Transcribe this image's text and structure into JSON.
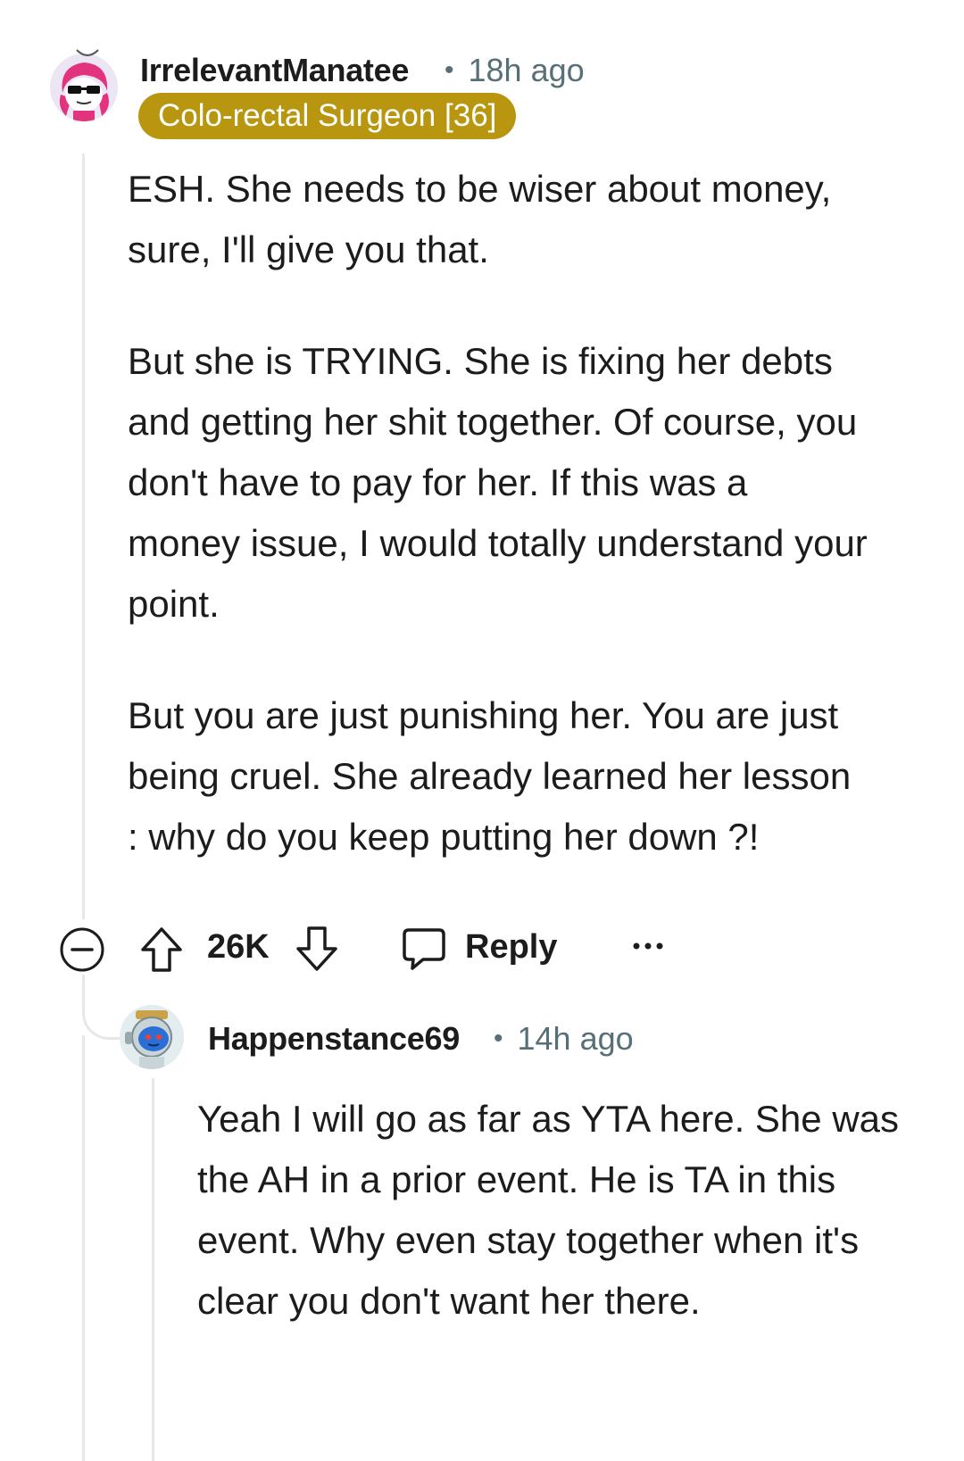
{
  "comment1": {
    "username": "IrrelevantManatee",
    "time": "18h ago",
    "flair": "Colo-rectal Surgeon [36]",
    "avatar_icon": "sunglasses-avatar-icon",
    "paragraphs": [
      "ESH. She needs to be wiser about money, sure, I'll give you that.",
      "But she is TRYING. She is fixing her debts and getting her shit together. Of course, you don't have to pay for her. If this was a money issue, I would totally understand your point.",
      "But you are just punishing her. You are just being cruel. She already learned her lesson : why do you keep putting her down ?!"
    ],
    "actions": {
      "collapse_icon": "minus-circle-icon",
      "upvote_icon": "arrow-up-icon",
      "score": "26K",
      "downvote_icon": "arrow-down-icon",
      "reply_icon": "speech-bubble-icon",
      "reply_label": "Reply",
      "more_icon": "more-dots-icon"
    }
  },
  "comment2": {
    "username": "Happenstance69",
    "time": "14h ago",
    "avatar_icon": "robot-avatar-icon",
    "paragraphs": [
      "Yeah I will go as far as YTA here. She was the AH in a prior event. He is TA in this event. Why even stay together when it's clear you don't want her there."
    ]
  },
  "colors": {
    "flair_bg": "#b8960f",
    "meta_text": "#576f76",
    "thread_line": "#e5e7e9"
  }
}
